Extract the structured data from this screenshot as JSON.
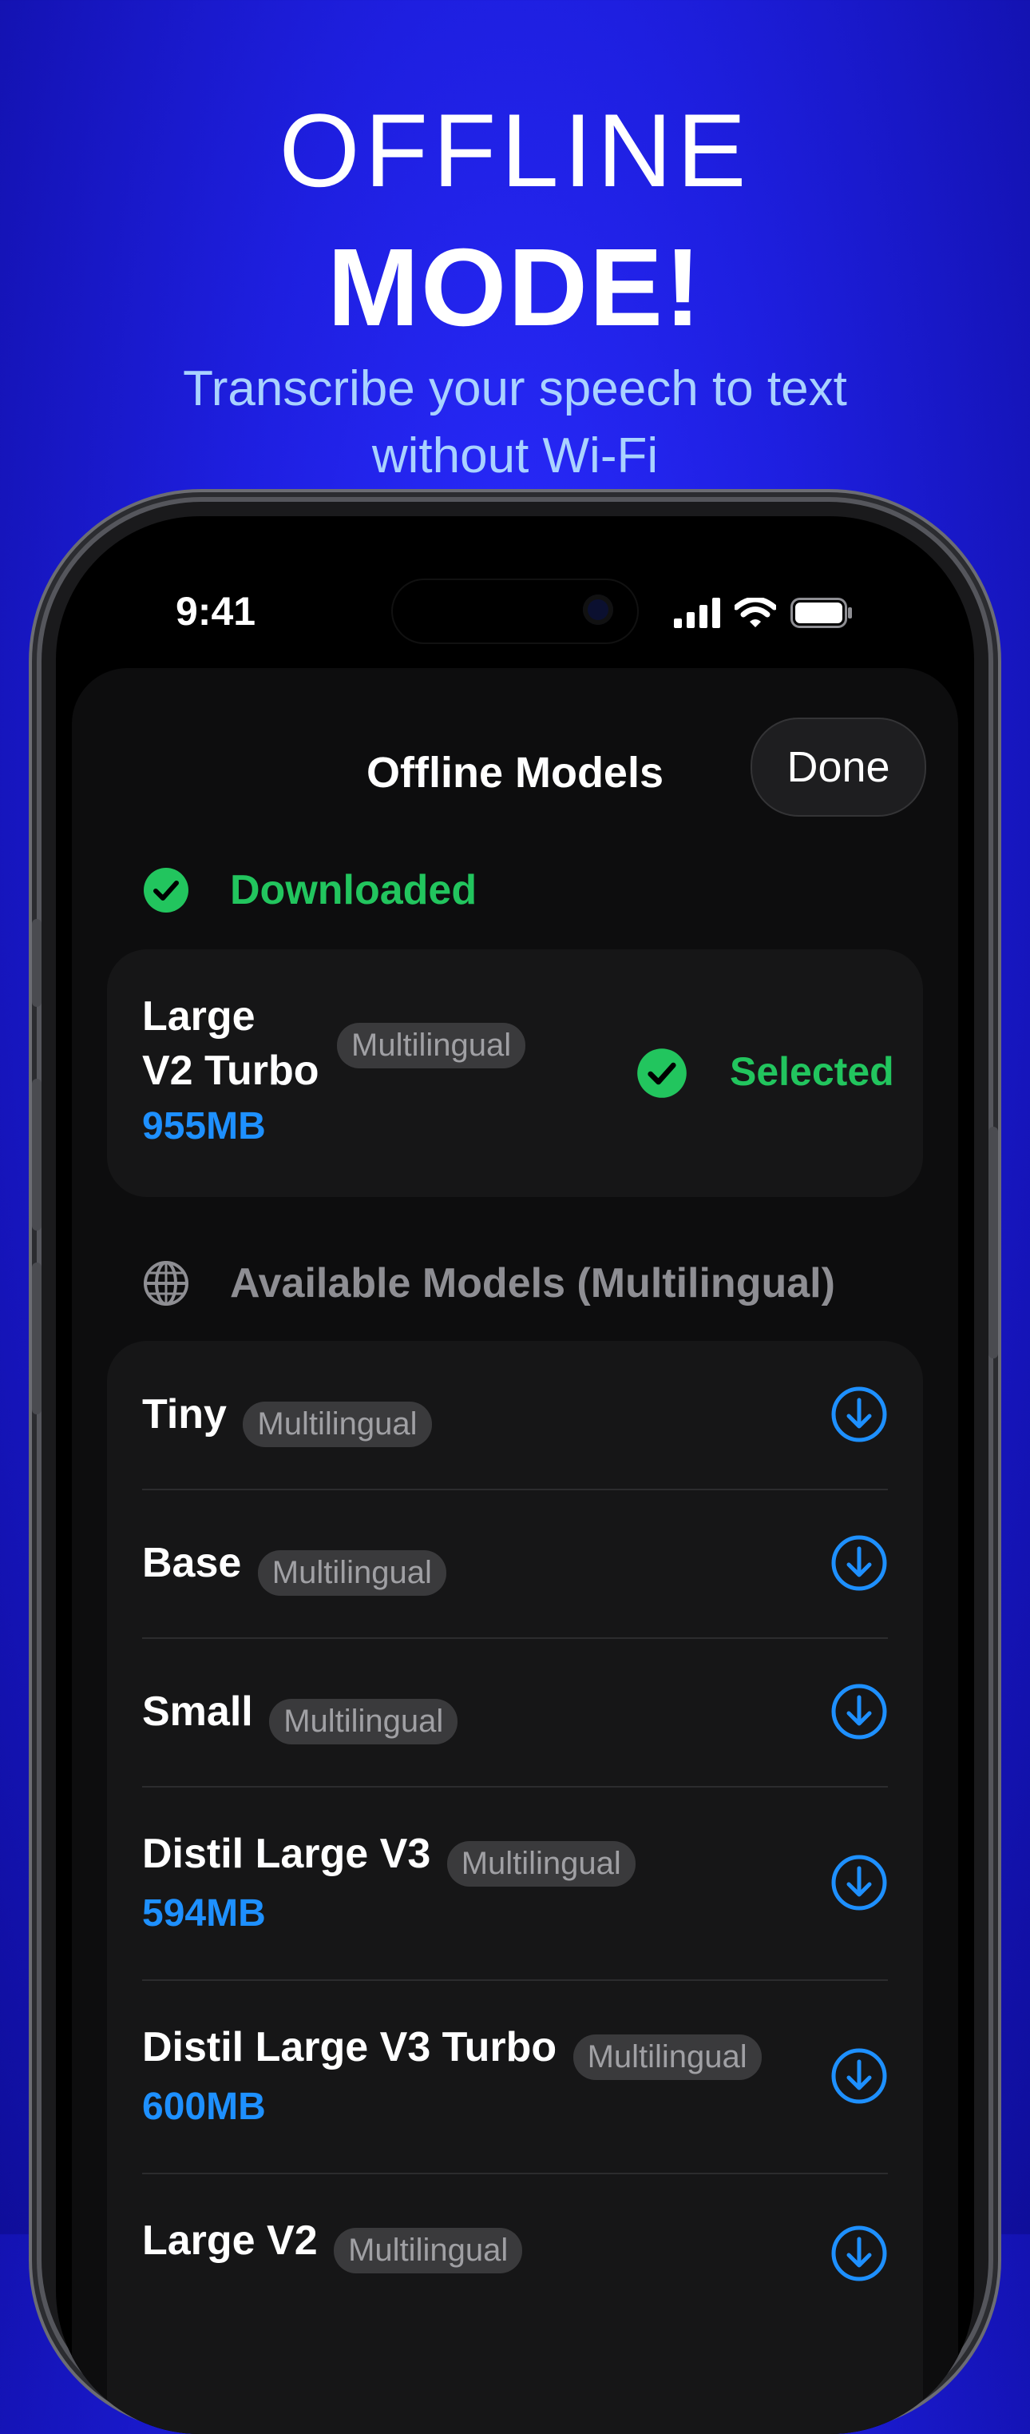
{
  "promo": {
    "line1": "OFFLINE",
    "line2": "MODE!",
    "subtitle_line1": "Transcribe your speech to text",
    "subtitle_line2": "without Wi-Fi"
  },
  "status_bar": {
    "time": "9:41"
  },
  "sheet": {
    "title": "Offline Models",
    "done_label": "Done",
    "downloaded_header": "Downloaded",
    "available_header": "Available Models (Multilingual)"
  },
  "downloaded": {
    "name_line1": "Large",
    "name_line2": "V2 Turbo",
    "tag": "Multilingual",
    "size": "955MB",
    "status": "Selected"
  },
  "available": [
    {
      "name": "Tiny",
      "tag": "Multilingual",
      "size": ""
    },
    {
      "name": "Base",
      "tag": "Multilingual",
      "size": ""
    },
    {
      "name": "Small",
      "tag": "Multilingual",
      "size": ""
    },
    {
      "name": "Distil Large V3",
      "tag": "Multilingual",
      "size": "594MB"
    },
    {
      "name": "Distil Large V3 Turbo",
      "tag": "Multilingual",
      "size": "600MB"
    },
    {
      "name": "Large V2",
      "tag": "Multilingual",
      "size": ""
    }
  ],
  "colors": {
    "background": "#1e1fe0",
    "accent_green": "#22c55e",
    "accent_blue": "#1e90ff",
    "subtitle": "#a9d2ff"
  },
  "icons": {
    "downloaded": "check-circle-icon",
    "available": "globe-icon",
    "download": "download-circle-icon",
    "selected": "check-circle-icon"
  }
}
